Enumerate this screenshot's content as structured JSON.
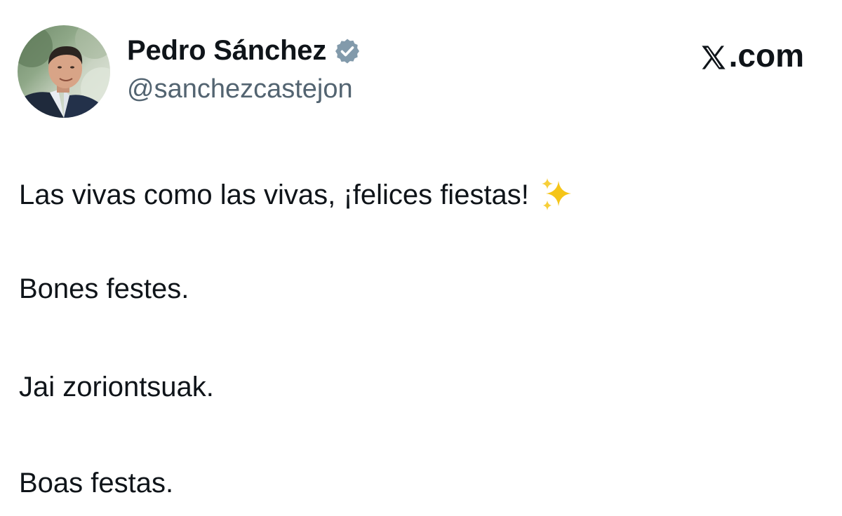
{
  "author": {
    "display_name": "Pedro Sánchez",
    "handle": "@sanchezcastejon",
    "verified_icon": "verified-badge-icon",
    "verified_color": "#829aab"
  },
  "brand": {
    "logo_icon": "x-logo-icon",
    "label": ".com"
  },
  "tweet": {
    "lines": [
      "Las vivas como las vivas, ¡felices fiestas!",
      "Bones festes.",
      "Jai zoriontsuak.",
      "Boas festas."
    ],
    "emoji_icon": "sparkles-icon"
  },
  "colors": {
    "text": "#0f1419",
    "secondary_text": "#536471",
    "background": "#ffffff",
    "sparkle": "#f5c518"
  }
}
